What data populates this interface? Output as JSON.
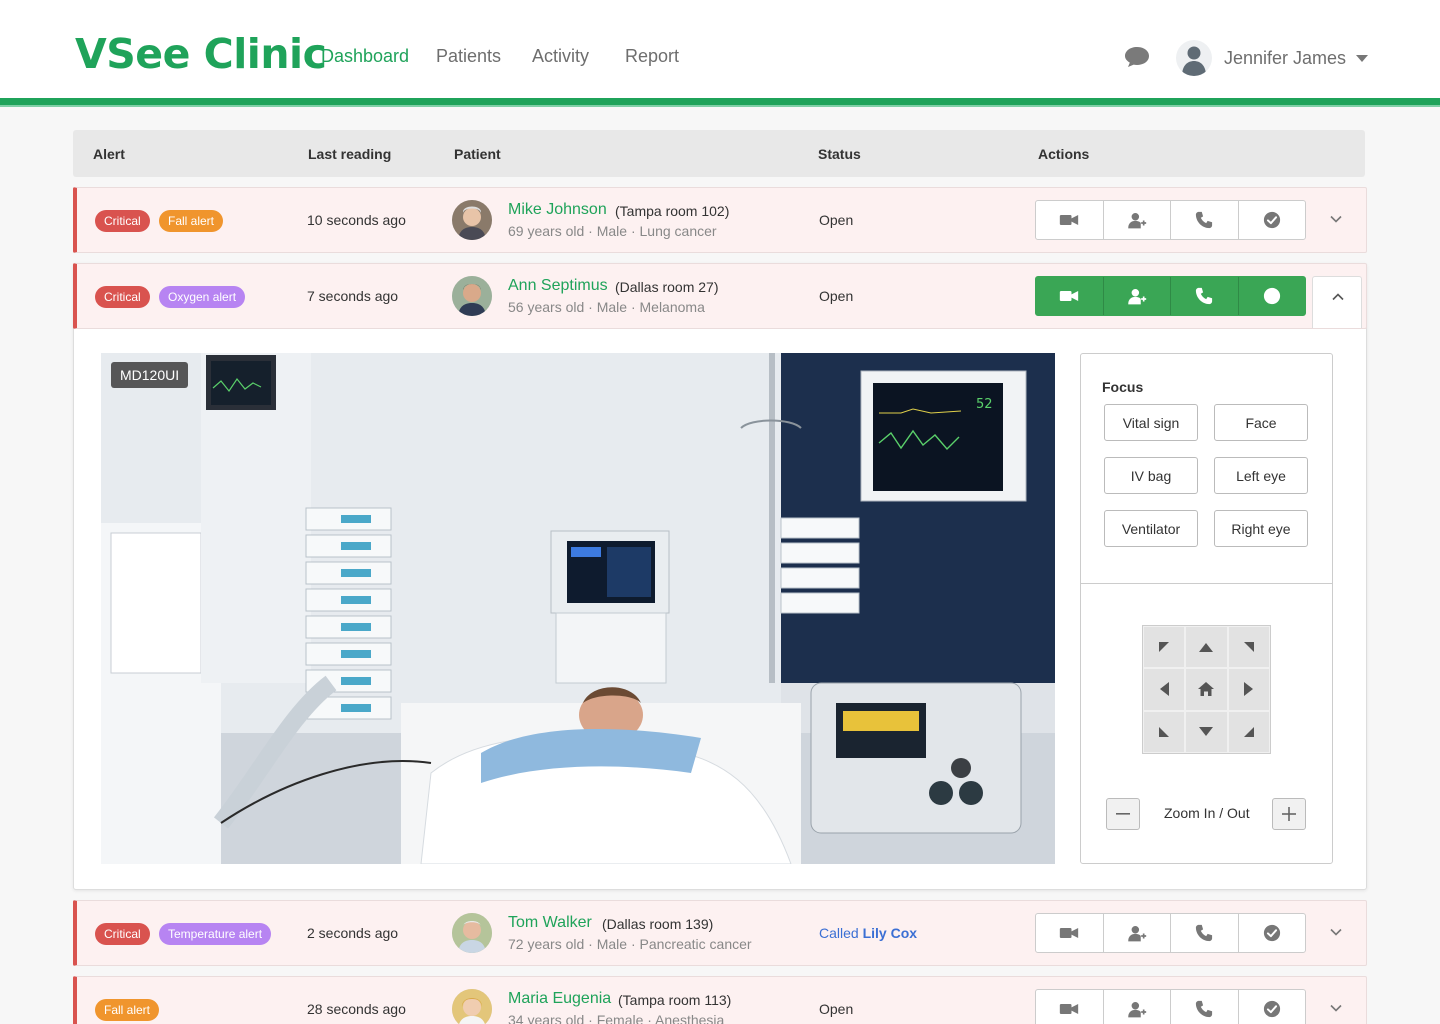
{
  "app": {
    "logo": "VSee Clinic",
    "nav": [
      "Dashboard",
      "Patients",
      "Activity",
      "Report"
    ],
    "active_nav": "Dashboard",
    "user_name": "Jennifer James"
  },
  "table": {
    "headers": [
      "Alert",
      "Last reading",
      "Patient",
      "Status",
      "Actions"
    ]
  },
  "rows": [
    {
      "alerts": [
        "Critical",
        "Fall alert"
      ],
      "reading": "10 seconds ago",
      "name": "Mike Johnson",
      "room": "(Tampa room 102)",
      "meta": "69 years old  ·  Male  ·  Lung cancer",
      "status": "Open"
    },
    {
      "alerts": [
        "Critical",
        "Oxygen alert"
      ],
      "reading": "7 seconds ago",
      "name": "Ann Septimus",
      "room": "(Dallas room 27)",
      "meta": "56 years old  ·  Male  ·  Melanoma",
      "status": "Open"
    },
    {
      "alerts": [
        "Critical",
        "Temperature alert"
      ],
      "reading": "2 seconds ago",
      "name": "Tom Walker",
      "room": "(Dallas room 139)",
      "meta": "72 years old  ·  Male  ·  Pancreatic cancer",
      "status_prefix": "Called",
      "status_name": "Lily Cox"
    },
    {
      "alerts": [
        "Fall alert"
      ],
      "reading": "28 seconds ago",
      "name": "Maria Eugenia",
      "room": "(Tampa room 113)",
      "meta": "34 years old  ·  Female  ·  Anesthesia",
      "status": "Open"
    }
  ],
  "video": {
    "label": "MD120UI"
  },
  "focus": {
    "title": "Focus",
    "buttons": [
      "Vital sign",
      "Face",
      "IV bag",
      "Left eye",
      "Ventilator",
      "Right eye"
    ],
    "zoom_label": "Zoom In / Out"
  },
  "colors": {
    "brand": "#1fa35a",
    "critical": "#d9534f",
    "fall": "#f0952d",
    "purple": "#b784f2",
    "called": "#3b6fd4",
    "action_active": "#3aa655"
  }
}
